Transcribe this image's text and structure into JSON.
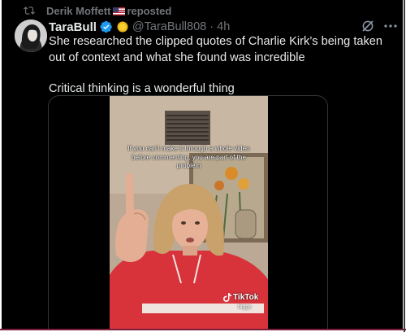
{
  "repost": {
    "reposter": "Derik Moffett",
    "label": "reposted"
  },
  "tweet": {
    "author_name": "TaraBull",
    "handle": "@TaraBull808",
    "separator": "·",
    "time": "4h",
    "text_line1": "She researched the clipped quotes of Charlie Kirk’s being taken out of context and what she found was incredible",
    "text_line2": "Critical thinking is a wonderful thing"
  },
  "video": {
    "caption": "If you can't make it through a whole video before commenting, you are part of the problem",
    "watermark": "TikTok",
    "watermark_user": "biggs"
  },
  "colors": {
    "background": "#000000",
    "text": "#e7e9ea",
    "muted": "#71767b",
    "verified_blue": "#1d9bf0",
    "hoodie_red": "#d8323a"
  },
  "icons": [
    "repost-icon",
    "us-flag-icon",
    "verified-badge-icon",
    "gold-coin-icon",
    "grok-icon",
    "more-icon",
    "tiktok-logo-icon"
  ]
}
